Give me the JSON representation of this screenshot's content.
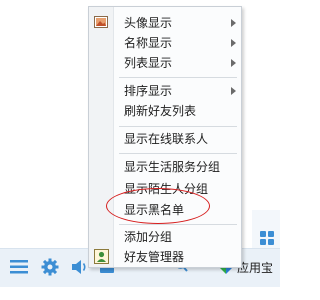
{
  "menu": {
    "items": [
      {
        "label": "头像显示",
        "icon": "avatar-image-icon",
        "has_submenu": true
      },
      {
        "label": "名称显示",
        "has_submenu": true
      },
      {
        "label": "列表显示",
        "has_submenu": true
      },
      {
        "label": "排序显示",
        "has_submenu": true
      },
      {
        "label": "刷新好友列表",
        "has_submenu": false
      },
      {
        "label": "显示在线联系人",
        "has_submenu": false
      },
      {
        "label": "显示生活服务分组",
        "has_submenu": false
      },
      {
        "label": "显示陌生人分组",
        "has_submenu": false
      },
      {
        "label": "显示黑名单",
        "has_submenu": false,
        "highlighted_by_annotation": true
      },
      {
        "label": "添加分组",
        "has_submenu": false
      },
      {
        "label": "好友管理器",
        "icon": "friend-manager-icon",
        "has_submenu": false
      }
    ]
  },
  "bottom_bar": {
    "icons": [
      "menu-icon",
      "settings-icon",
      "speaker-icon",
      "mail-icon",
      "search-icon"
    ],
    "app_store_label": "应用宝"
  },
  "colors": {
    "accent_blue": "#3c8ed4",
    "annotation_red": "#d61e1e"
  }
}
